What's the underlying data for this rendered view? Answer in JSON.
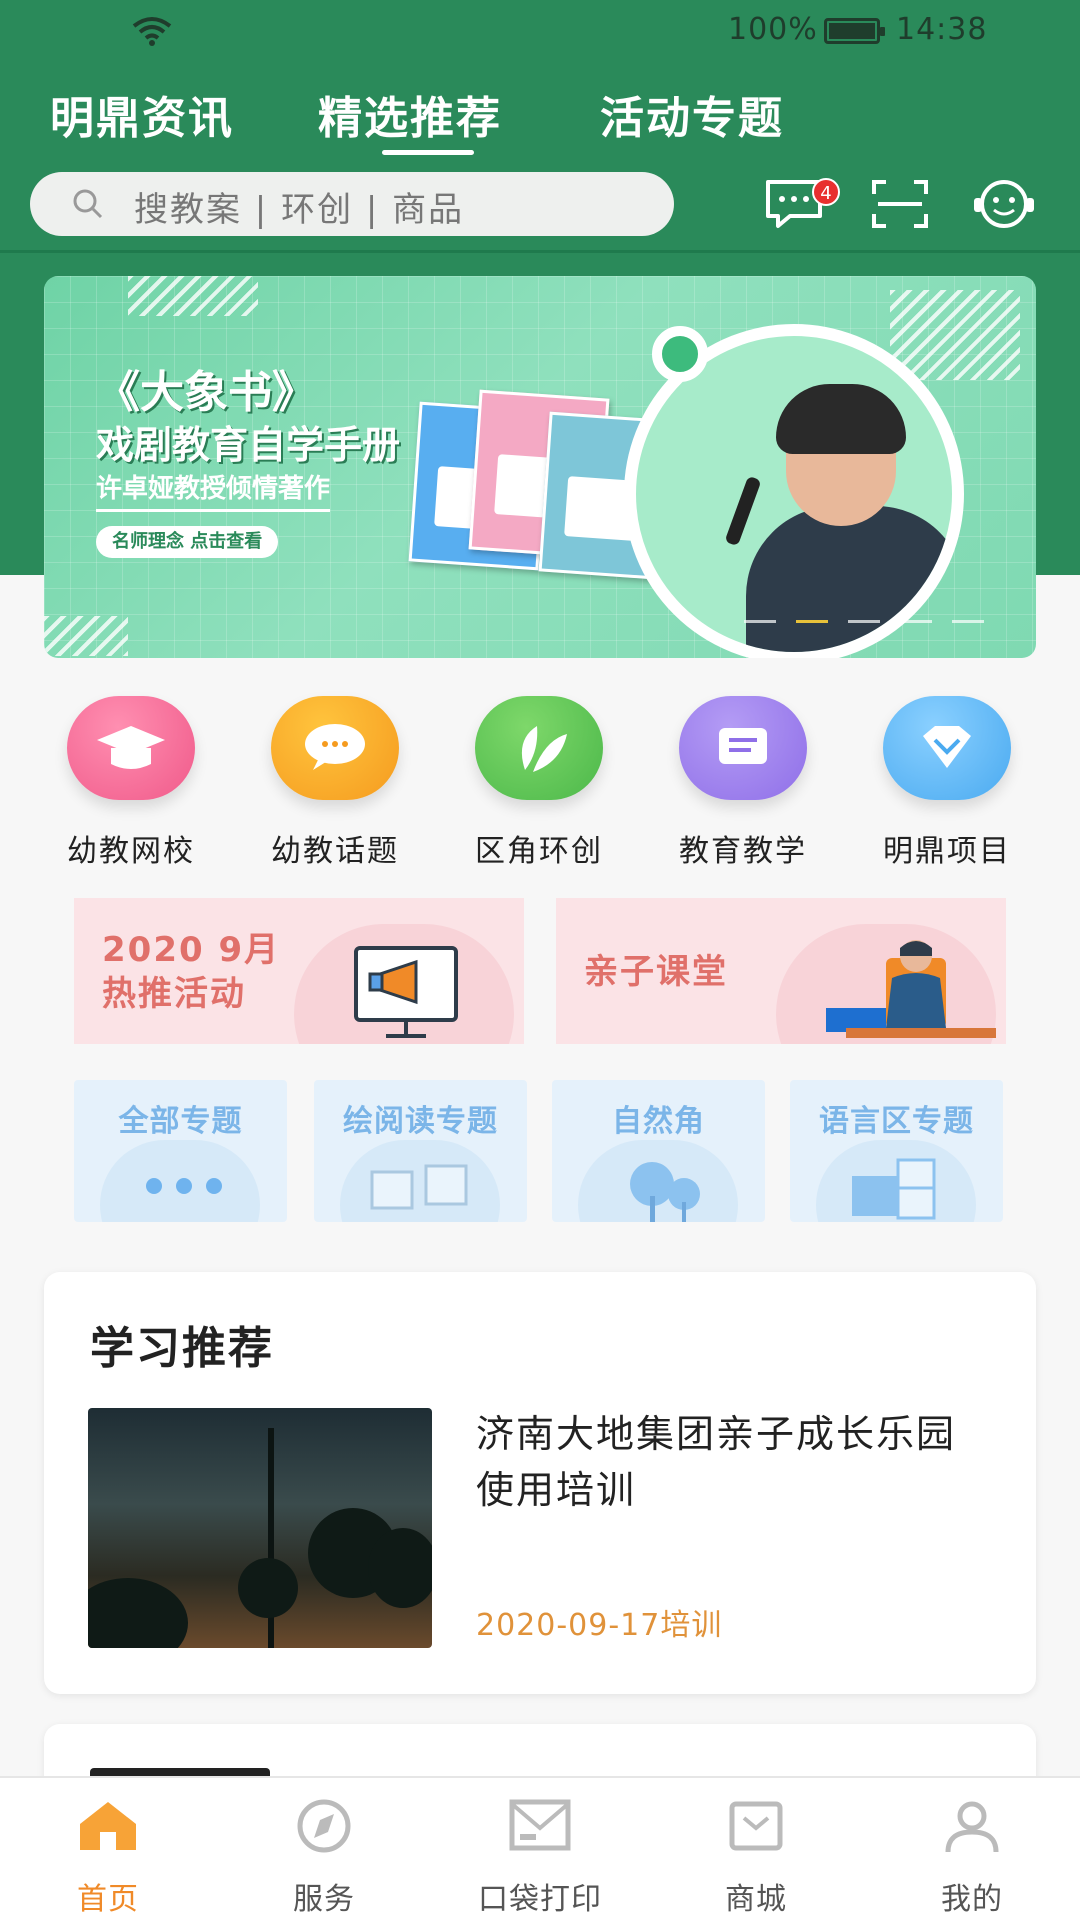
{
  "status": {
    "battery": "100%",
    "time": "14:38"
  },
  "tabs": [
    "明鼎资讯",
    "精选推荐",
    "活动专题"
  ],
  "active_tab": "精选推荐",
  "search": {
    "placeholder": "搜教案 | 环创 | 商品"
  },
  "header_icons": {
    "message_badge": "4"
  },
  "banner": {
    "title": "《大象书》",
    "subtitle": "戏剧教育自学手册",
    "author": "许卓娅教授倾情著作",
    "button": "名师理念  点击查看"
  },
  "categories": [
    {
      "label": "幼教网校",
      "icon": "graduation-cap-icon",
      "color": "#f05a8a"
    },
    {
      "label": "幼教话题",
      "icon": "chat-bubble-icon",
      "color": "#f59b1f"
    },
    {
      "label": "区角环创",
      "icon": "leaf-icon",
      "color": "#4cb84a"
    },
    {
      "label": "教育教学",
      "icon": "book-icon",
      "color": "#8f6fe8"
    },
    {
      "label": "明鼎项目",
      "icon": "diamond-icon",
      "color": "#4aaaf0"
    }
  ],
  "promos": [
    {
      "line1": "2020 9月",
      "line2": "热推活动"
    },
    {
      "line1": "亲子课堂"
    }
  ],
  "topics": [
    "全部专题",
    "绘阅读专题",
    "自然角",
    "语言区专题"
  ],
  "recommend": {
    "title": "学习推荐",
    "article_title": "济南大地集团亲子成长乐园使用培训",
    "article_meta": "2020-09-17培训"
  },
  "bottom_nav": [
    {
      "label": "首页",
      "icon": "home-icon"
    },
    {
      "label": "服务",
      "icon": "compass-icon"
    },
    {
      "label": "口袋打印",
      "icon": "mail-icon"
    },
    {
      "label": "商城",
      "icon": "shop-icon"
    },
    {
      "label": "我的",
      "icon": "user-icon"
    }
  ],
  "colors": {
    "brand_green": "#2a8a5a",
    "accent_orange": "#f08a28"
  }
}
